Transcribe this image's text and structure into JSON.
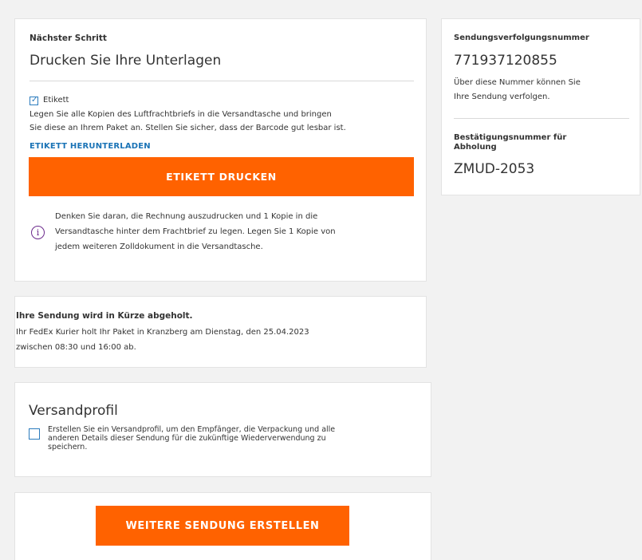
{
  "print_card": {
    "step_label": "Nächster Schritt",
    "title": "Drucken Sie Ihre Unterlagen",
    "label_checkbox_text": "Etikett",
    "label_checked": true,
    "instructions_line1": "Legen Sie alle Kopien des Luftfrachtbriefs in die Versandtasche und bringen",
    "instructions_line2": "Sie diese an Ihrem Paket an. Stellen Sie sicher, dass der Barcode gut lesbar ist.",
    "download_link": "ETIKETT HERUNTERLADEN",
    "print_button": "ETIKETT DRUCKEN",
    "info_line1": "Denken Sie daran, die Rechnung auszudrucken und 1 Kopie in die",
    "info_line2": "Versandtasche hinter dem Frachtbrief zu legen. Legen Sie 1 Kopie von",
    "info_line3": "jedem weiteren Zolldokument in die Versandtasche.",
    "info_icon_glyph": "i"
  },
  "pickup_card": {
    "title": "Ihre Sendung wird in Kürze abgeholt.",
    "line1": "Ihr FedEx Kurier holt Ihr Paket in Kranzberg am Dienstag, den 25.04.2023",
    "line2": "zwischen 08:30 und 16:00 ab."
  },
  "profile_card": {
    "title": "Versandprofil",
    "checked": false,
    "line1": "Erstellen Sie ein Versandprofil, um den Empfänger, die Verpackung und alle",
    "line2": "anderen Details dieser Sendung für die zukünftige Wiederverwendung zu",
    "line3": "speichern."
  },
  "new_shipment_button": "WEITERE SENDUNG ERSTELLEN",
  "tracking_card": {
    "tracking_label": "Sendungsverfolgungsnummer",
    "tracking_number": "771937120855",
    "tracking_hint_line1": "Über diese Nummer können Sie",
    "tracking_hint_line2": "Ihre Sendung verfolgen.",
    "pickup_label_line1": "Bestätigungsnummer für",
    "pickup_label_line2": "Abholung",
    "pickup_number": "ZMUD-2053"
  },
  "colors": {
    "accent_orange": "#ff6200",
    "link_blue": "#1a73b6",
    "checkbox_blue": "#2b7bbd",
    "info_purple": "#6c2a8c"
  }
}
